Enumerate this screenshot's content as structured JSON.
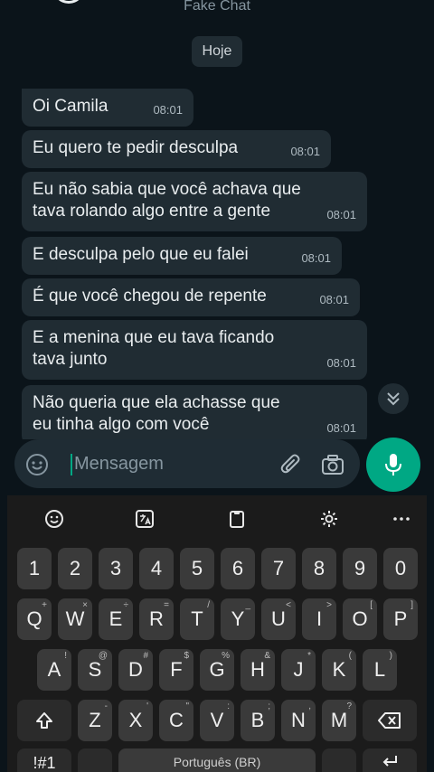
{
  "header": {
    "title": "Fake Chat"
  },
  "date_chip": "Hoje",
  "messages": [
    {
      "text": "Oi Camila",
      "time": "08:01"
    },
    {
      "text": "Eu quero te pedir desculpa",
      "time": "08:01"
    },
    {
      "text": "Eu não sabia que você achava que tava rolando algo entre a gente",
      "time": "08:01"
    },
    {
      "text": "E desculpa pelo que eu falei",
      "time": "08:01"
    },
    {
      "text": "É que você chegou de repente",
      "time": "08:01"
    },
    {
      "text": "E a menina que eu tava ficando tava junto",
      "time": "08:01"
    },
    {
      "text": "Não queria que ela achasse que eu tinha algo com você",
      "time": "08:01"
    }
  ],
  "composer": {
    "placeholder": "Mensagem"
  },
  "keyboard": {
    "number_row": [
      "1",
      "2",
      "3",
      "4",
      "5",
      "6",
      "7",
      "8",
      "9",
      "0"
    ],
    "row1": [
      {
        "k": "Q",
        "h": "+"
      },
      {
        "k": "W",
        "h": "×"
      },
      {
        "k": "E",
        "h": "÷"
      },
      {
        "k": "R",
        "h": "="
      },
      {
        "k": "T",
        "h": "/"
      },
      {
        "k": "Y",
        "h": "_"
      },
      {
        "k": "U",
        "h": "<"
      },
      {
        "k": "I",
        "h": ">"
      },
      {
        "k": "O",
        "h": "["
      },
      {
        "k": "P",
        "h": "]"
      }
    ],
    "row2": [
      {
        "k": "A",
        "h": "!"
      },
      {
        "k": "S",
        "h": "@"
      },
      {
        "k": "D",
        "h": "#"
      },
      {
        "k": "F",
        "h": "$"
      },
      {
        "k": "G",
        "h": "%"
      },
      {
        "k": "H",
        "h": "&"
      },
      {
        "k": "J",
        "h": "*"
      },
      {
        "k": "K",
        "h": "("
      },
      {
        "k": "L",
        "h": ")"
      }
    ],
    "row3": [
      {
        "k": "Z",
        "h": "-"
      },
      {
        "k": "X",
        "h": "'"
      },
      {
        "k": "C",
        "h": "\""
      },
      {
        "k": "V",
        "h": ":"
      },
      {
        "k": "B",
        "h": ";"
      },
      {
        "k": "N",
        "h": ","
      },
      {
        "k": "M",
        "h": "?"
      }
    ],
    "symbols_label": "!#1",
    "space_label": "Português (BR)"
  },
  "colors": {
    "accent": "#00a884",
    "bubble": "#202c33",
    "background": "#0b141a"
  }
}
